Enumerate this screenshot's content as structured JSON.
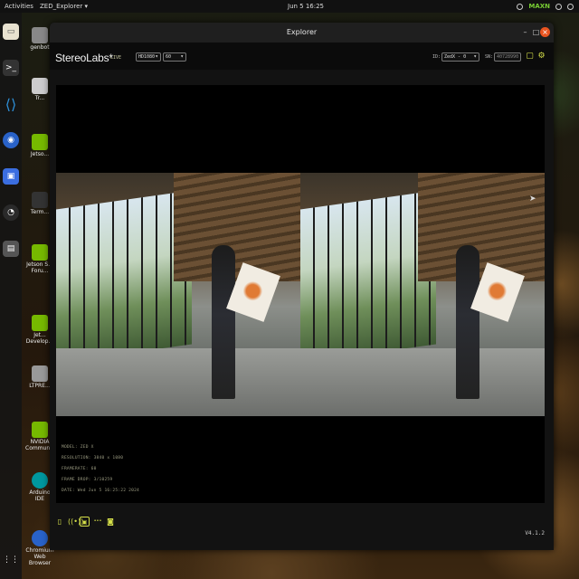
{
  "topbar": {
    "activities": "Activities",
    "app_menu": "ZED_Explorer ▾",
    "clock": "Jun 5 16:25",
    "tray_nvidia": "MAXN"
  },
  "desktop_icons": [
    {
      "label": "genbot"
    },
    {
      "label": "Tr..."
    },
    {
      "label": "Jetso..."
    },
    {
      "label": "Term..."
    },
    {
      "label": "Jetson S... Foru..."
    },
    {
      "label": "Jet... Develop..."
    },
    {
      "label": "LTPRE..."
    },
    {
      "label": "NVIDIA Communit..."
    },
    {
      "label": "Arduino IDE"
    },
    {
      "label": "Chromium Web Browser"
    }
  ],
  "window": {
    "title": "Explorer",
    "logo": "StereoLabs*",
    "live_label": "LIVE",
    "resolution_select": "HD1080",
    "fps_select": "60",
    "id_label": "ID:",
    "id_select": "ZedX - 0",
    "sn_label": "SN:",
    "sn_value": "40728990",
    "camera_info": {
      "model": "MODEL: ZED X",
      "resolution": "RESOLUTION: 3840 x 1080",
      "framerate": "FRAMERATE: 60",
      "frame_drop": "FRAME DROP: 3/10259",
      "date": "DATE: Wed Jun 5 16:25:22 2024"
    },
    "version": "V4.1.2"
  },
  "colors": {
    "accent": "#d6e04a",
    "close_button": "#e95420"
  }
}
